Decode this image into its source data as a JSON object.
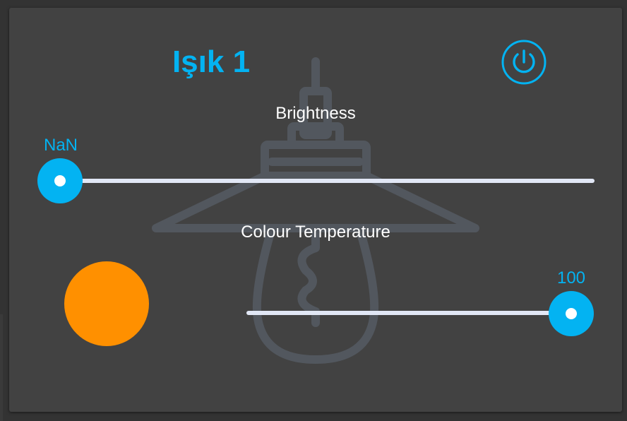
{
  "card": {
    "title": "Işık 1",
    "power_icon": "power-icon",
    "background_icon": "lightbulb-icon",
    "accent_color": "#03b3f2"
  },
  "brightness": {
    "label": "Brightness",
    "value_text": "NaN",
    "fraction": 0.0
  },
  "colour_temperature": {
    "label": "Colour Temperature",
    "value_text": "100",
    "fraction": 1.0,
    "swatch_color": "#ff9000"
  }
}
